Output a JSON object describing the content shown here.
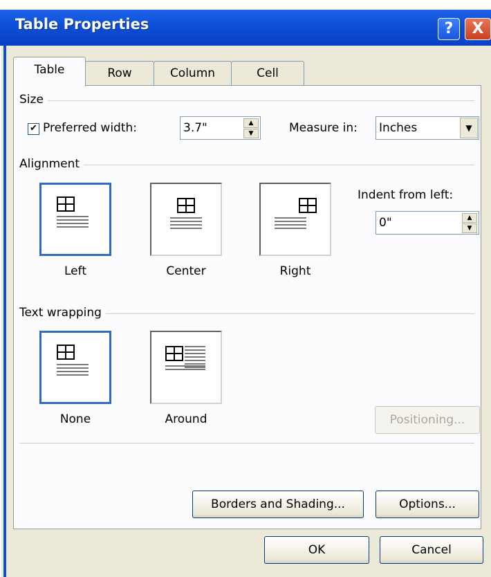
{
  "window": {
    "title": "Table Properties",
    "help_glyph": "?",
    "close_glyph": "X"
  },
  "tabs": [
    {
      "label": "Table",
      "active": true
    },
    {
      "label": "Row",
      "active": false
    },
    {
      "label": "Column",
      "active": false
    },
    {
      "label": "Cell",
      "active": false
    }
  ],
  "size": {
    "group_label": "Size",
    "preferred_width_checked": true,
    "preferred_width_label": "Preferred width:",
    "preferred_width_value": "3.7\"",
    "measure_in_label": "Measure in:",
    "measure_in_value": "Inches"
  },
  "alignment": {
    "group_label": "Alignment",
    "options": [
      "Left",
      "Center",
      "Right"
    ],
    "selected": "Left",
    "indent_label": "Indent from left:",
    "indent_value": "0\""
  },
  "text_wrapping": {
    "group_label": "Text wrapping",
    "options": [
      "None",
      "Around"
    ],
    "selected": "None",
    "positioning_label": "Positioning..."
  },
  "buttons": {
    "borders_shading": "Borders and Shading...",
    "options": "Options...",
    "ok": "OK",
    "cancel": "Cancel"
  },
  "colors": {
    "titlebar": "#0c4fd6",
    "selection": "#316ac5",
    "dialog_bg": "#ece9d8"
  }
}
